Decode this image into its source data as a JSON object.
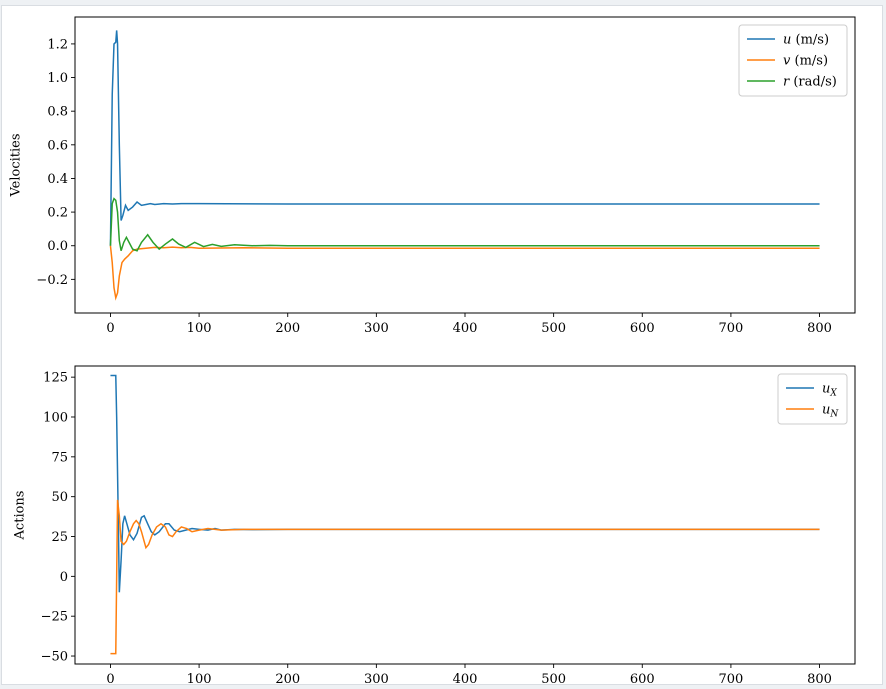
{
  "chart_data": [
    {
      "type": "line",
      "title": "",
      "xlabel": "",
      "ylabel": "Velocities",
      "xlim": [
        -40,
        840
      ],
      "ylim": [
        -0.4,
        1.36
      ],
      "xticks": [
        0,
        100,
        200,
        300,
        400,
        500,
        600,
        700,
        800
      ],
      "xtick_labels": [
        "0",
        "100",
        "200",
        "300",
        "400",
        "500",
        "600",
        "700",
        "800"
      ],
      "yticks": [
        -0.2,
        0.0,
        0.2,
        0.4,
        0.6,
        0.8,
        1.0,
        1.2
      ],
      "ytick_labels": [
        "−0.2",
        "0.0",
        "0.2",
        "0.4",
        "0.6",
        "0.8",
        "1.0",
        "1.2"
      ],
      "grid": false,
      "legend_position": "top-right",
      "series": [
        {
          "name": "u (m/s)",
          "legend_var": "u",
          "legend_unit": "(m/s)",
          "color": "#1f77b4",
          "points": [
            [
              0,
              0
            ],
            [
              2,
              0.9
            ],
            [
              4,
              1.2
            ],
            [
              6,
              1.21
            ],
            [
              7,
              1.28
            ],
            [
              8,
              1.2
            ],
            [
              10,
              0.6
            ],
            [
              12,
              0.15
            ],
            [
              14,
              0.18
            ],
            [
              17,
              0.24
            ],
            [
              20,
              0.21
            ],
            [
              25,
              0.23
            ],
            [
              30,
              0.26
            ],
            [
              35,
              0.24
            ],
            [
              40,
              0.245
            ],
            [
              45,
              0.25
            ],
            [
              50,
              0.245
            ],
            [
              60,
              0.25
            ],
            [
              70,
              0.248
            ],
            [
              80,
              0.25
            ],
            [
              100,
              0.25
            ],
            [
              200,
              0.248
            ],
            [
              400,
              0.248
            ],
            [
              600,
              0.248
            ],
            [
              800,
              0.248
            ]
          ]
        },
        {
          "name": "v (m/s)",
          "legend_var": "v",
          "legend_unit": "(m/s)",
          "color": "#ff7f0e",
          "points": [
            [
              0,
              0
            ],
            [
              2,
              -0.1
            ],
            [
              4,
              -0.25
            ],
            [
              6,
              -0.31
            ],
            [
              8,
              -0.28
            ],
            [
              10,
              -0.18
            ],
            [
              13,
              -0.1
            ],
            [
              16,
              -0.08
            ],
            [
              20,
              -0.06
            ],
            [
              25,
              -0.03
            ],
            [
              30,
              -0.02
            ],
            [
              40,
              -0.015
            ],
            [
              50,
              -0.01
            ],
            [
              60,
              -0.012
            ],
            [
              70,
              -0.008
            ],
            [
              80,
              -0.012
            ],
            [
              90,
              -0.01
            ],
            [
              100,
              -0.015
            ],
            [
              150,
              -0.012
            ],
            [
              200,
              -0.015
            ],
            [
              400,
              -0.015
            ],
            [
              600,
              -0.015
            ],
            [
              800,
              -0.015
            ]
          ]
        },
        {
          "name": "r (rad/s)",
          "legend_var": "r",
          "legend_unit": "(rad/s)",
          "color": "#2ca02c",
          "points": [
            [
              0,
              0
            ],
            [
              2,
              0.25
            ],
            [
              4,
              0.28
            ],
            [
              6,
              0.27
            ],
            [
              8,
              0.2
            ],
            [
              10,
              0.03
            ],
            [
              12,
              -0.03
            ],
            [
              15,
              0.02
            ],
            [
              18,
              0.05
            ],
            [
              21,
              0.02
            ],
            [
              25,
              -0.02
            ],
            [
              30,
              -0.03
            ],
            [
              35,
              0.02
            ],
            [
              42,
              0.065
            ],
            [
              48,
              0.02
            ],
            [
              55,
              -0.02
            ],
            [
              62,
              0.01
            ],
            [
              70,
              0.04
            ],
            [
              77,
              0.01
            ],
            [
              85,
              -0.01
            ],
            [
              95,
              0.02
            ],
            [
              105,
              -0.005
            ],
            [
              115,
              0.008
            ],
            [
              125,
              -0.004
            ],
            [
              140,
              0.006
            ],
            [
              160,
              0.0
            ],
            [
              180,
              0.002
            ],
            [
              200,
              0.0
            ],
            [
              400,
              0.0
            ],
            [
              600,
              0.0
            ],
            [
              800,
              0.0
            ]
          ]
        }
      ]
    },
    {
      "type": "line",
      "title": "",
      "xlabel": "",
      "ylabel": "Actions",
      "xlim": [
        -40,
        840
      ],
      "ylim": [
        -55,
        132
      ],
      "xticks": [
        0,
        100,
        200,
        300,
        400,
        500,
        600,
        700,
        800
      ],
      "xtick_labels": [
        "0",
        "100",
        "200",
        "300",
        "400",
        "500",
        "600",
        "700",
        "800"
      ],
      "yticks": [
        -50,
        -25,
        0,
        25,
        50,
        75,
        100,
        125
      ],
      "ytick_labels": [
        "−50",
        "−25",
        "0",
        "25",
        "50",
        "75",
        "100",
        "125"
      ],
      "grid": false,
      "legend_position": "top-right",
      "series": [
        {
          "name": "u_X",
          "legend_var": "u",
          "legend_sub": "X",
          "color": "#1f77b4",
          "points": [
            [
              0,
              126
            ],
            [
              6,
              126
            ],
            [
              7,
              100
            ],
            [
              9,
              30
            ],
            [
              10,
              -10
            ],
            [
              12,
              10
            ],
            [
              14,
              33
            ],
            [
              16,
              38
            ],
            [
              19,
              32
            ],
            [
              22,
              26
            ],
            [
              26,
              23
            ],
            [
              30,
              27
            ],
            [
              35,
              37
            ],
            [
              38,
              38
            ],
            [
              42,
              33
            ],
            [
              46,
              28
            ],
            [
              50,
              26
            ],
            [
              55,
              28
            ],
            [
              62,
              33
            ],
            [
              66,
              33
            ],
            [
              72,
              29
            ],
            [
              78,
              28
            ],
            [
              85,
              29
            ],
            [
              92,
              30
            ],
            [
              100,
              29.5
            ],
            [
              110,
              29
            ],
            [
              118,
              30
            ],
            [
              125,
              29
            ],
            [
              140,
              29.5
            ],
            [
              160,
              29.3
            ],
            [
              200,
              29.5
            ],
            [
              400,
              29.5
            ],
            [
              600,
              29.5
            ],
            [
              800,
              29.5
            ]
          ]
        },
        {
          "name": "u_N",
          "legend_var": "u",
          "legend_sub": "N",
          "color": "#ff7f0e",
          "points": [
            [
              0,
              -48.5
            ],
            [
              6,
              -48.5
            ],
            [
              7,
              0
            ],
            [
              8,
              48
            ],
            [
              10,
              38
            ],
            [
              12,
              22
            ],
            [
              15,
              20
            ],
            [
              18,
              22
            ],
            [
              22,
              28
            ],
            [
              26,
              33
            ],
            [
              29,
              35
            ],
            [
              32,
              33
            ],
            [
              35,
              28
            ],
            [
              38,
              22
            ],
            [
              40,
              18
            ],
            [
              43,
              20
            ],
            [
              47,
              26
            ],
            [
              52,
              31
            ],
            [
              57,
              33
            ],
            [
              62,
              31
            ],
            [
              66,
              26
            ],
            [
              70,
              25
            ],
            [
              74,
              28
            ],
            [
              80,
              31
            ],
            [
              86,
              30
            ],
            [
              92,
              28
            ],
            [
              100,
              29
            ],
            [
              110,
              30
            ],
            [
              125,
              29
            ],
            [
              150,
              29.5
            ],
            [
              200,
              29.5
            ],
            [
              400,
              29.5
            ],
            [
              600,
              29.5
            ],
            [
              800,
              29.5
            ]
          ]
        }
      ]
    }
  ]
}
